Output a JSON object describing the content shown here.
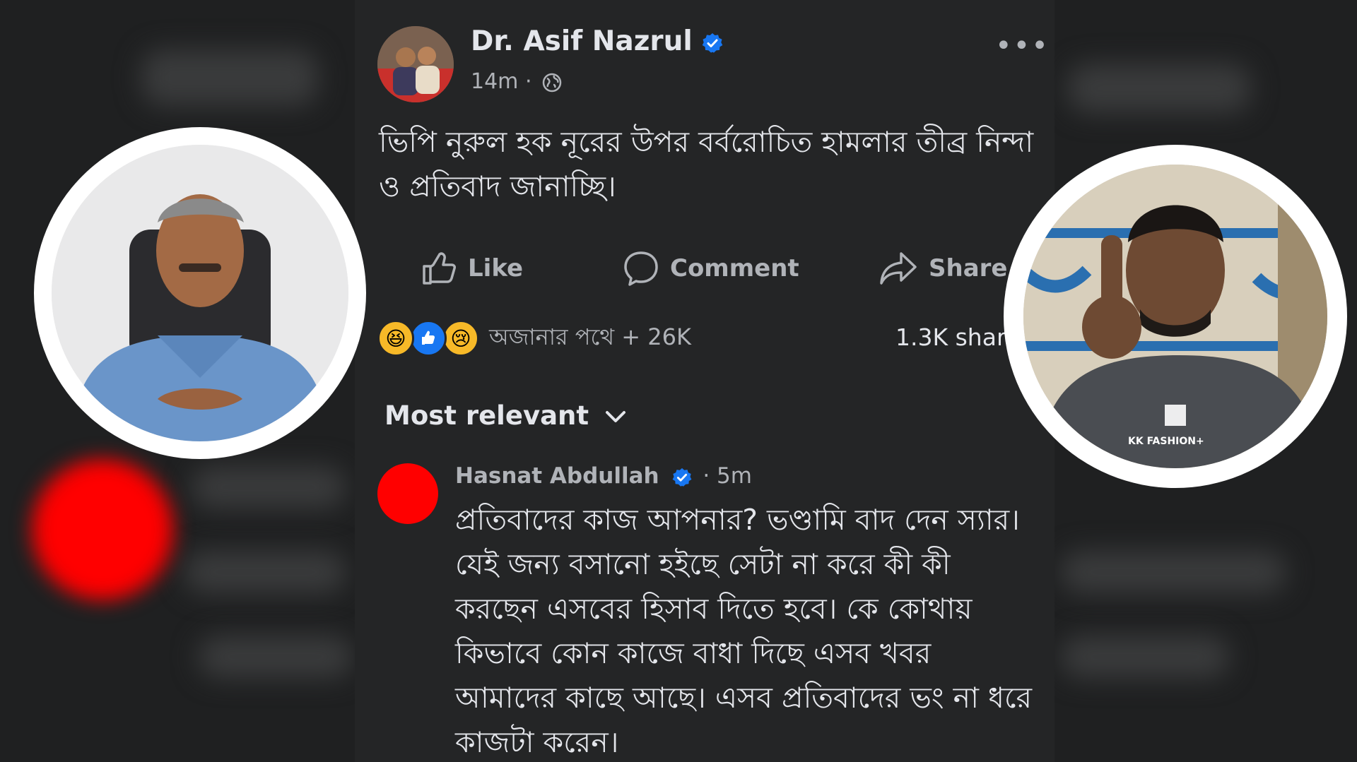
{
  "post": {
    "author": "Dr. Asif Nazrul",
    "time": "14m",
    "text": "ভিপি নুরুল হক নূরের উপর বর্বরোচিত হামলার তীব্র নিন্দা ও প্রতিবাদ জানাচ্ছি।",
    "actions": {
      "like": "Like",
      "comment": "Comment",
      "share": "Share"
    },
    "reactions_text": "অজানার পথে + 26K",
    "shares": "1.3K shar"
  },
  "sort_label": "Most relevant",
  "comment": {
    "name": "Hasnat Abdullah",
    "time": "· 5m",
    "text": "প্রতিবাদের কাজ আপনার? ভণ্ডামি বাদ দেন স্যার।যেই জন্য বসানো হইছে সেটা না করে কী কী করছেন এসবের হিসাব দিতে হবে। কে কোথায় কিভাবে কোন কাজে বাধা দিছে এসব খবর আমাদের কাছে আছে। এসব প্রতিবাদের ভং না ধরে কাজটা করেন।"
  },
  "overlay": {
    "right_shirt_text": "KK FASHION+"
  },
  "colors": {
    "accent": "#1877f2",
    "bg": "#242526",
    "text": "#e4e6eb",
    "muted": "#b0b3b8"
  }
}
